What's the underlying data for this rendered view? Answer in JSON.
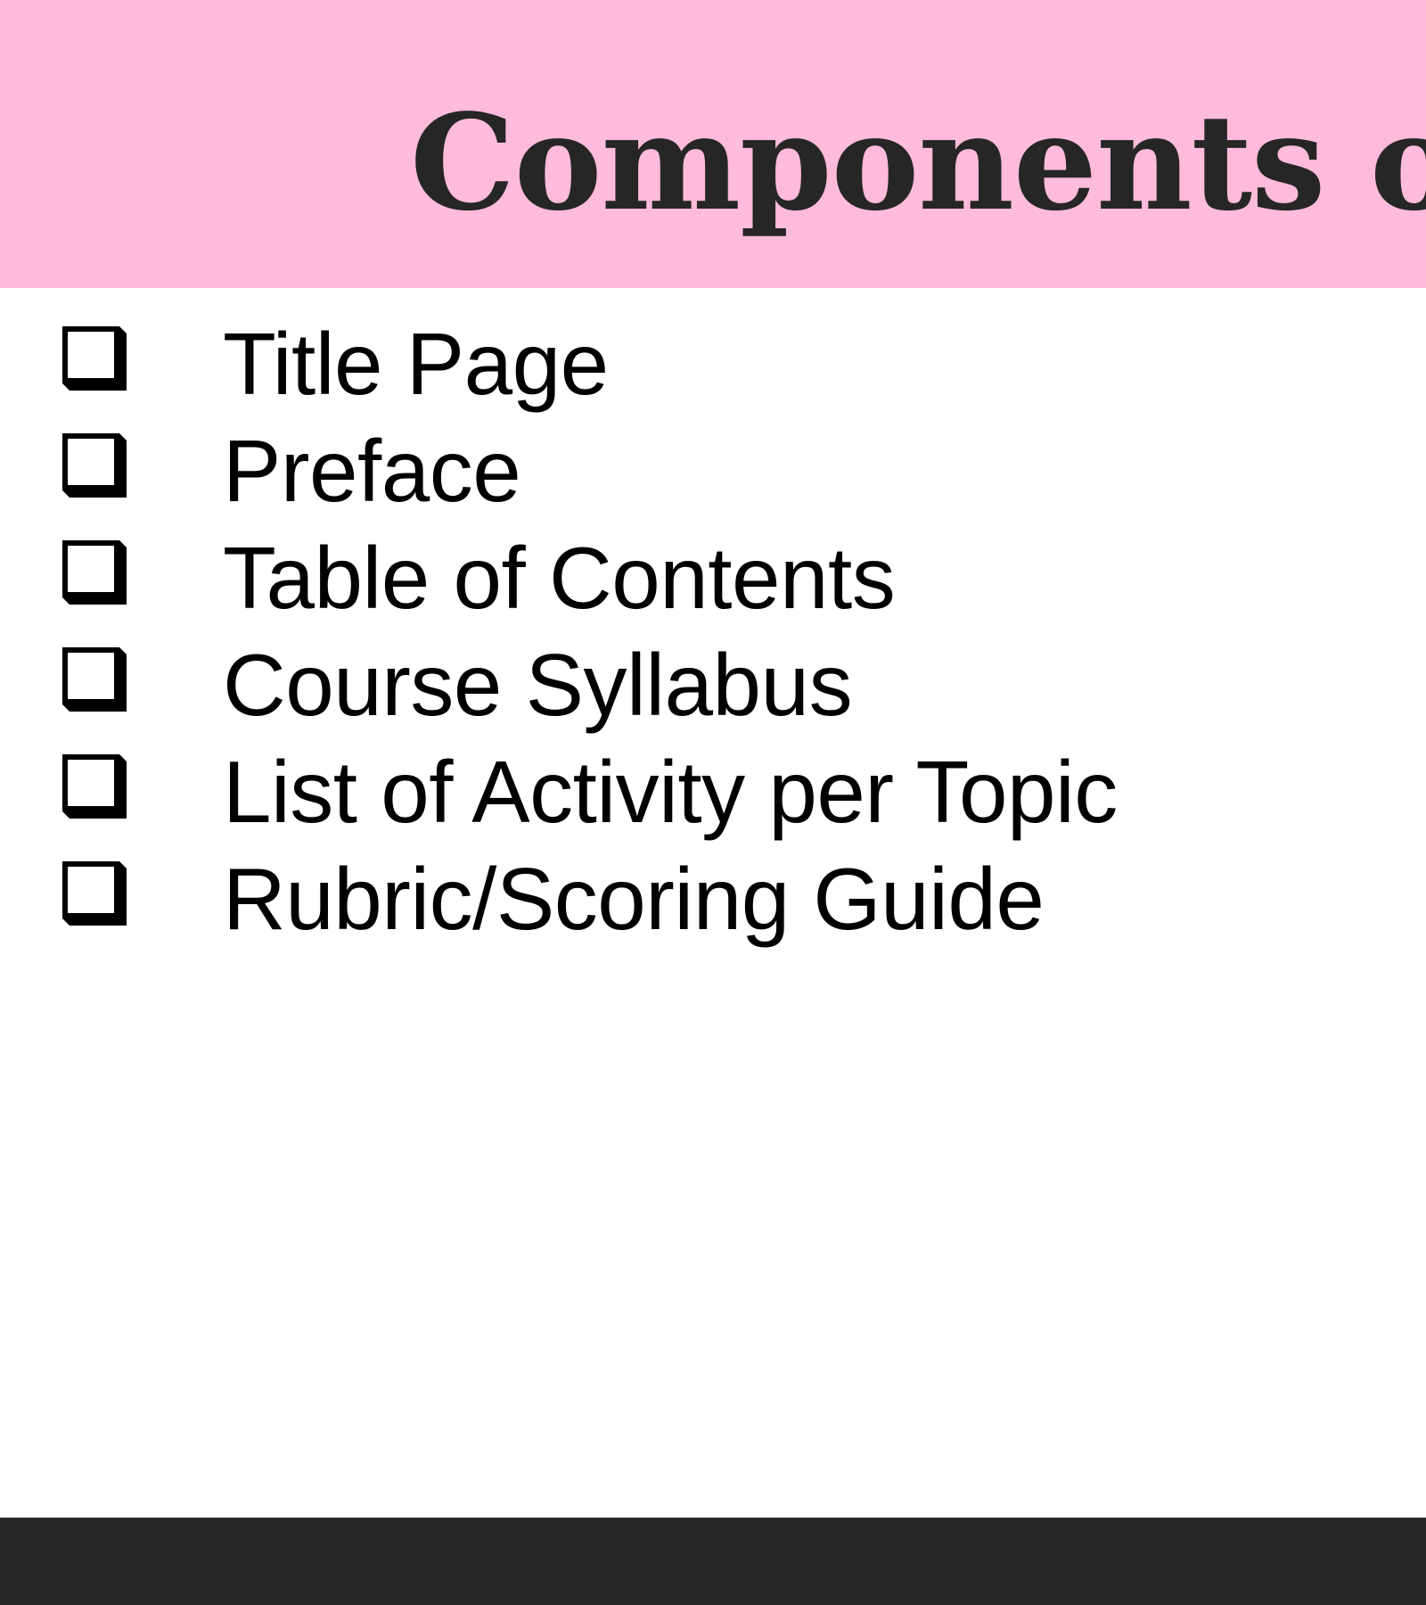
{
  "slide": {
    "title": "Components of a",
    "items": [
      {
        "label": "Title Page",
        "icon": "square-checkbox-icon"
      },
      {
        "label": "Preface",
        "icon": "square-checkbox-icon"
      },
      {
        "label": "Table of Contents",
        "icon": "square-checkbox-icon"
      },
      {
        "label": "Course Syllabus",
        "icon": "square-checkbox-icon"
      },
      {
        "label": "List of Activity per Topic",
        "icon": "square-checkbox-icon"
      },
      {
        "label": "Rubric/Scoring Guide",
        "icon": "square-checkbox-icon"
      }
    ]
  },
  "colors": {
    "header_background": "#ffbbdb",
    "title_text": "#262626",
    "body_text": "#000000",
    "footer_background": "#262626",
    "page_background": "#ffffff"
  }
}
